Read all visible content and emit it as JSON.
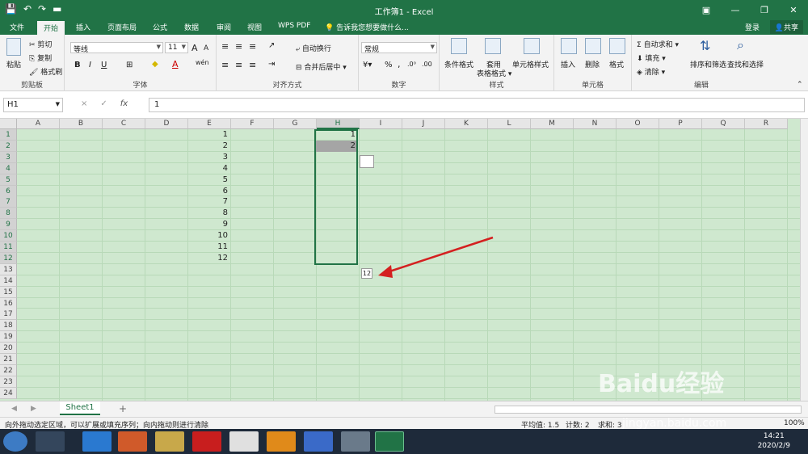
{
  "window": {
    "title": "工作簿1 - Excel"
  },
  "tabs": [
    "文件",
    "开始",
    "插入",
    "页面布局",
    "公式",
    "数据",
    "审阅",
    "视图",
    "WPS PDF"
  ],
  "active_tab": "开始",
  "tell_me": "告诉我您想要做什么...",
  "account": {
    "login": "登录",
    "share": "共享"
  },
  "ribbon": {
    "clipboard": {
      "paste": "粘贴",
      "cut": "剪切",
      "copy": "复制",
      "format_painter": "格式刷",
      "label": "剪贴板"
    },
    "font": {
      "name": "等线",
      "size": "11",
      "bold": "B",
      "italic": "I",
      "underline": "U",
      "grow": "A",
      "shrink": "A",
      "wen": "wén",
      "font_color": "A",
      "label": "字体"
    },
    "alignment": {
      "wrap": "自动换行",
      "merge": "合并后居中",
      "label": "对齐方式"
    },
    "number": {
      "format": "常规",
      "percent": "%",
      "comma": ",",
      "label": "数字"
    },
    "styles": {
      "conditional": "条件格式",
      "table": "套用\n表格格式",
      "cell_styles": "单元格样式",
      "label": "样式"
    },
    "cells": {
      "insert": "插入",
      "delete": "删除",
      "format": "格式",
      "label": "单元格"
    },
    "editing": {
      "autosum": "自动求和",
      "fill": "填充",
      "clear": "清除",
      "sort": "排序和筛选",
      "find": "查找和选择",
      "label": "编辑"
    }
  },
  "formula_bar": {
    "name_box": "H1",
    "cancel": "×",
    "confirm": "✓",
    "fx": "fx",
    "value": "1"
  },
  "columns": [
    "A",
    "B",
    "C",
    "D",
    "E",
    "F",
    "G",
    "H",
    "I",
    "J",
    "K",
    "L",
    "M",
    "N",
    "O",
    "P",
    "Q",
    "R"
  ],
  "rows": [
    "1",
    "2",
    "3",
    "4",
    "5",
    "6",
    "7",
    "8",
    "9",
    "10",
    "11",
    "12",
    "13",
    "14",
    "15",
    "16",
    "17",
    "18",
    "19",
    "20",
    "21",
    "22",
    "23",
    "24"
  ],
  "column_e_values": [
    "1",
    "2",
    "3",
    "4",
    "5",
    "6",
    "7",
    "8",
    "9",
    "10",
    "11",
    "12"
  ],
  "column_h_values": [
    "1",
    "2"
  ],
  "fill_tooltip": "12",
  "sheet": {
    "tab": "Sheet1",
    "add": "+"
  },
  "status": {
    "message": "向外拖动选定区域，可以扩展或填充序列；向内拖动则进行清除",
    "average": "平均值: 1.5",
    "count": "计数: 2",
    "sum": "求和: 3",
    "zoom": "100%"
  },
  "taskbar": {
    "time": "14:21",
    "date": "2020/2/9"
  },
  "watermark": {
    "logo": "Baidu经验",
    "url": "jingyan.baidu.com"
  },
  "colors": {
    "excel_green": "#217346",
    "grid_bg": "#cfe8cf",
    "arrow": "#d42020"
  }
}
